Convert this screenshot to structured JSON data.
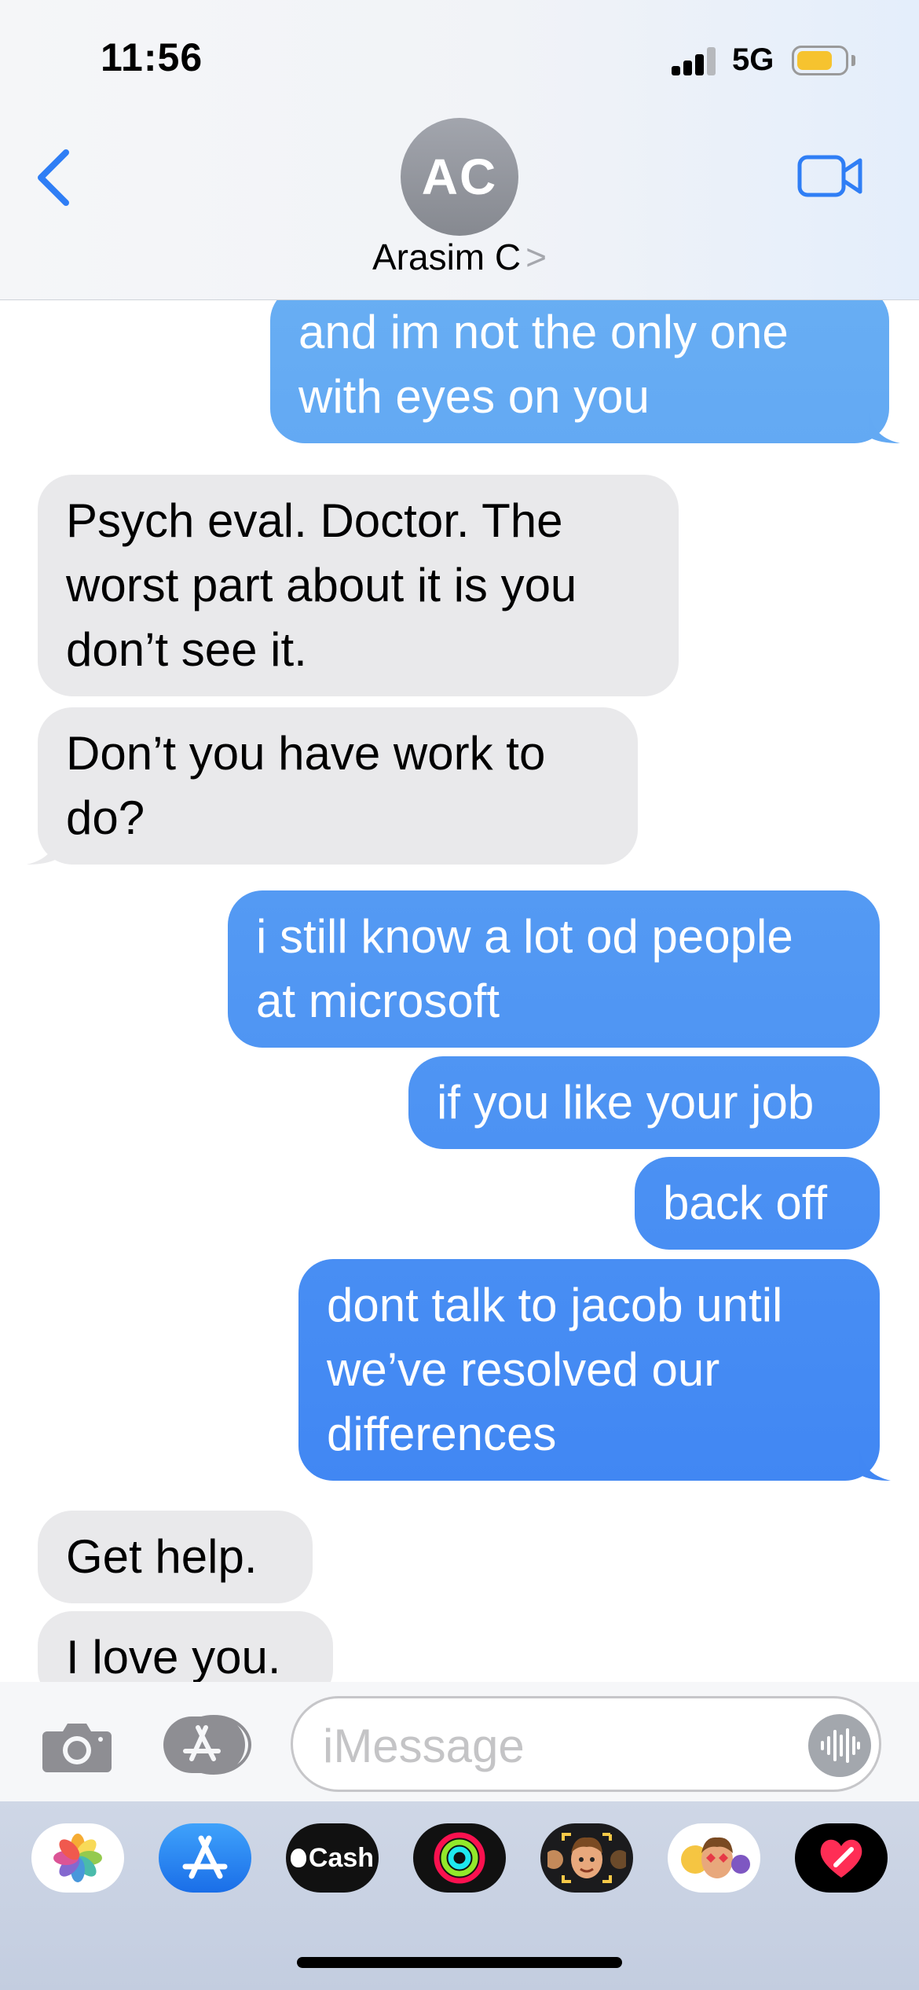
{
  "status_bar": {
    "time": "11:56",
    "network": "5G",
    "battery_level": 0.75
  },
  "header": {
    "back_icon": "chevron-left-icon",
    "avatar_initials": "AC",
    "contact_name": "Arasim C",
    "contact_chevron": ">",
    "video_icon": "video-camera-icon"
  },
  "messages": [
    {
      "from": "me",
      "lines": [
        "and im not the only one",
        "with eyes on you"
      ]
    },
    {
      "from": "them",
      "lines": [
        "Psych eval. Doctor. The",
        "worst part about it is you",
        "don’t see it."
      ]
    },
    {
      "from": "them",
      "lines": [
        "Don’t you have work to",
        "do?"
      ]
    },
    {
      "from": "me",
      "lines": [
        "i still know a lot od people",
        "at microsoft"
      ]
    },
    {
      "from": "me",
      "lines": [
        "if you like your job"
      ]
    },
    {
      "from": "me",
      "lines": [
        "back off"
      ]
    },
    {
      "from": "me",
      "lines": [
        "dont talk to jacob until",
        "we’ve resolved our",
        "differences"
      ]
    },
    {
      "from": "them",
      "lines": [
        "Get help."
      ]
    },
    {
      "from": "them",
      "lines": [
        "I love you."
      ]
    }
  ],
  "input": {
    "placeholder": "iMessage",
    "camera_icon": "camera-icon",
    "apps_icon": "app-store-icon",
    "audio_icon": "audio-waveform-icon"
  },
  "app_drawer": {
    "apps": [
      {
        "name": "photos-app-icon"
      },
      {
        "name": "app-store-app-icon"
      },
      {
        "name": "apple-cash-app-icon",
        "label": "Cash"
      },
      {
        "name": "fitness-activity-app-icon"
      },
      {
        "name": "memoji-app-icon"
      },
      {
        "name": "memoji-stickers-app-icon"
      },
      {
        "name": "digital-touch-app-icon"
      }
    ]
  },
  "colors": {
    "blue_top": "#68aef3",
    "blue_bottom": "#3a80f3",
    "gray_bubble": "#e9e9eb",
    "ios_blue": "#2f7ef5"
  }
}
